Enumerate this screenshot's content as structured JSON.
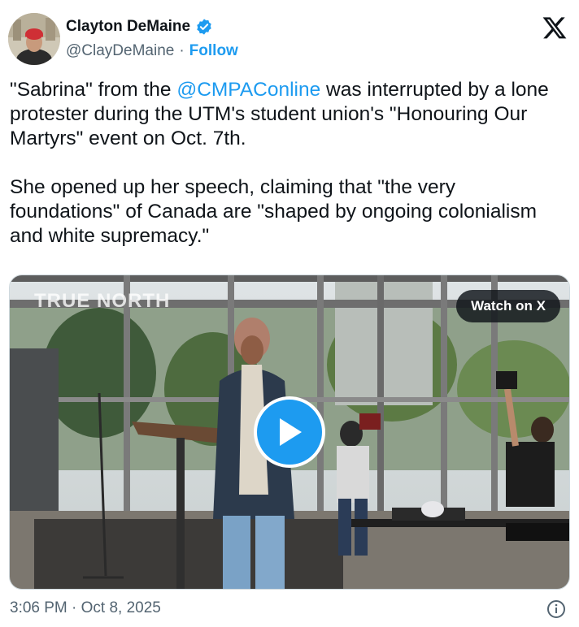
{
  "author": {
    "display_name": "Clayton DeMaine",
    "handle": "@ClayDeMaine",
    "separator": "·",
    "follow_label": "Follow",
    "verified_color": "#1d9bf0"
  },
  "tweet": {
    "text_part1": "\"Sabrina\" from the ",
    "mention": "@CMPAConline",
    "text_part2": " was interrupted by a lone protester during the UTM's student union's \"Honouring Our Martyrs\" event on Oct. 7th.\n\nShe opened up her speech, claiming that \"the very foundations\" of Canada are \"shaped by ongoing colonialism and white supremacy.\""
  },
  "media": {
    "watermark": "TRUE NORTH",
    "watch_label": "Watch on X"
  },
  "footer": {
    "timestamp": "3:06 PM · Oct 8, 2025"
  },
  "icons": {
    "logo": "x-logo-icon",
    "verified": "verified-badge-icon",
    "play": "play-icon",
    "info": "info-icon"
  }
}
